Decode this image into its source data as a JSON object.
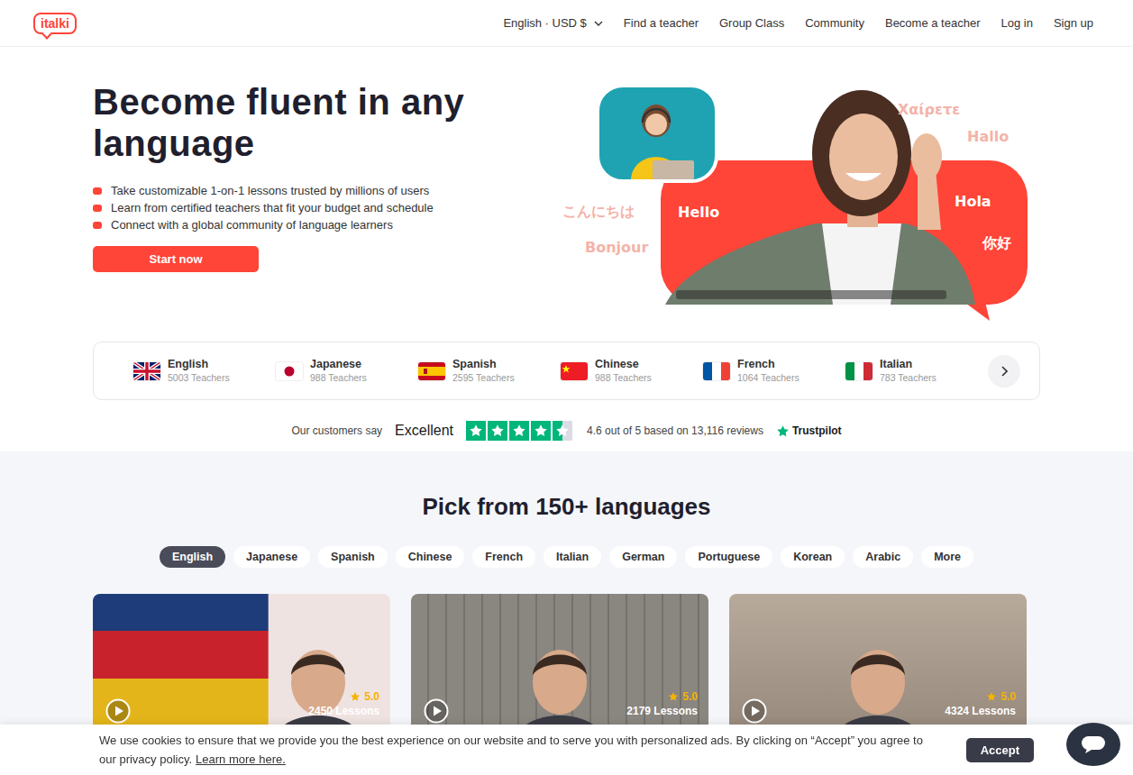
{
  "logo": {
    "text": "italki"
  },
  "nav": {
    "locale": "English · USD $",
    "links": [
      "Find a teacher",
      "Group Class",
      "Community",
      "Become a teacher",
      "Log in",
      "Sign up"
    ]
  },
  "hero": {
    "title": "Become fluent in any language",
    "bullets": [
      "Take customizable 1-on-1 lessons trusted by millions of users",
      "Learn from certified teachers that fit your budget and schedule",
      "Connect with a global community of language learners"
    ],
    "button": "Start now",
    "greetings": [
      {
        "text": "Χαίρετε",
        "color": "#f4b3a9"
      },
      {
        "text": "Hallo",
        "color": "#f4b3a9"
      },
      {
        "text": "こんにちは",
        "color": "#f4b3a9"
      },
      {
        "text": "Hello",
        "color": "#ffffff"
      },
      {
        "text": "Hola",
        "color": "#ffffff"
      },
      {
        "text": "你好",
        "color": "#ffffff"
      },
      {
        "text": "Bonjour",
        "color": "#f4b3a9"
      }
    ]
  },
  "language_strip": {
    "items": [
      {
        "name": "English",
        "teachers": "5003 Teachers"
      },
      {
        "name": "Japanese",
        "teachers": "988 Teachers"
      },
      {
        "name": "Spanish",
        "teachers": "2595 Teachers"
      },
      {
        "name": "Chinese",
        "teachers": "988 Teachers"
      },
      {
        "name": "French",
        "teachers": "1064 Teachers"
      },
      {
        "name": "Italian",
        "teachers": "783 Teachers"
      }
    ]
  },
  "trust": {
    "prefix": "Our customers say",
    "rating_word": "Excellent",
    "stars": 4.5,
    "summary": "4.6 out of 5 based on 13,116 reviews",
    "brand": "Trustpilot"
  },
  "languages": {
    "title": "Pick from 150+ languages",
    "tabs": [
      {
        "label": "English",
        "selected": true
      },
      {
        "label": "Japanese",
        "selected": false
      },
      {
        "label": "Spanish",
        "selected": false
      },
      {
        "label": "Chinese",
        "selected": false
      },
      {
        "label": "French",
        "selected": false
      },
      {
        "label": "Italian",
        "selected": false
      },
      {
        "label": "German",
        "selected": false
      },
      {
        "label": "Portuguese",
        "selected": false
      },
      {
        "label": "Korean",
        "selected": false
      },
      {
        "label": "Arabic",
        "selected": false
      },
      {
        "label": "More",
        "selected": false
      }
    ]
  },
  "teachers": [
    {
      "rating": "5.0",
      "lessons": "2450 Lessons"
    },
    {
      "rating": "5.0",
      "lessons": "2179 Lessons"
    },
    {
      "rating": "5.0",
      "lessons": "4324 Lessons"
    }
  ],
  "cookie": {
    "text": "We use cookies to ensure that we provide you the best experience on our website and to serve you with personalized ads. By clicking on “Accept” you agree to our privacy policy.",
    "link": "Learn more here.",
    "button": "Accept"
  }
}
